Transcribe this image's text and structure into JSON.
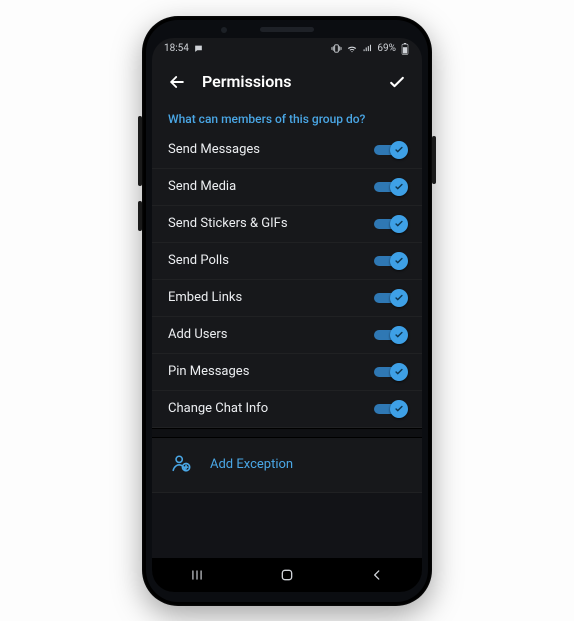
{
  "status": {
    "time": "18:54",
    "battery": "69%"
  },
  "header": {
    "title": "Permissions"
  },
  "section": {
    "question": "What can members of this group do?"
  },
  "permissions": [
    {
      "label": "Send Messages",
      "on": true
    },
    {
      "label": "Send Media",
      "on": true
    },
    {
      "label": "Send Stickers & GIFs",
      "on": true
    },
    {
      "label": "Send Polls",
      "on": true
    },
    {
      "label": "Embed Links",
      "on": true
    },
    {
      "label": "Add Users",
      "on": true
    },
    {
      "label": "Pin Messages",
      "on": true
    },
    {
      "label": "Change Chat Info",
      "on": true
    }
  ],
  "addException": {
    "label": "Add Exception"
  },
  "colors": {
    "accent": "#4aa7e6",
    "bg": "#17181b"
  }
}
